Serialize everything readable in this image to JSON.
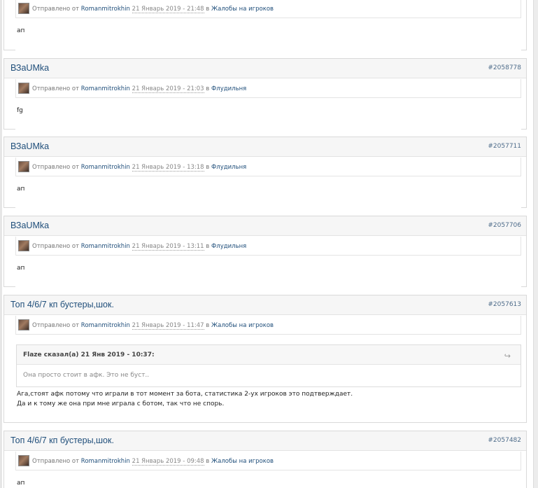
{
  "posts": [
    {
      "title": "",
      "number": "",
      "meta": {
        "prefix": "Отправлено от",
        "author": "Romanmitrokhin",
        "date": "21 Январь 2019 - 21:48",
        "in": "в",
        "forum": "Жалобы на игроков"
      },
      "body": [
        "ап"
      ]
    },
    {
      "title": "ВЗаUMka",
      "number": "#2058778",
      "meta": {
        "prefix": "Отправлено от",
        "author": "Romanmitrokhin",
        "date": "21 Январь 2019 - 21:03",
        "in": "в",
        "forum": "Флудильня"
      },
      "body": [
        "fg"
      ]
    },
    {
      "title": "ВЗаUMka",
      "number": "#2057711",
      "meta": {
        "prefix": "Отправлено от",
        "author": "Romanmitrokhin",
        "date": "21 Январь 2019 - 13:18",
        "in": "в",
        "forum": "Флудильня"
      },
      "body": [
        "ап"
      ]
    },
    {
      "title": "ВЗаUMka",
      "number": "#2057706",
      "meta": {
        "prefix": "Отправлено от",
        "author": "Romanmitrokhin",
        "date": "21 Январь 2019 - 13:11",
        "in": "в",
        "forum": "Флудильня"
      },
      "body": [
        "ап"
      ]
    },
    {
      "title": "Топ 4/6/7 кп бустеры,шок.",
      "number": "#2057613",
      "meta": {
        "prefix": "Отправлено от",
        "author": "Romanmitrokhin",
        "date": "21 Январь 2019 - 11:47",
        "in": "в",
        "forum": "Жалобы на игроков"
      },
      "quote": {
        "cite": "Flaze сказал(а) 21 Янв 2019 - 10:37:",
        "text": "Она просто стоит в афк. Это не буст.."
      },
      "body": [
        "Ага,стоят афк потому что играли в тот момент за бота, статистика 2-ух игроков это подтверждает.",
        "Да и к тому же она при мне играла с ботом, так что не спорь."
      ]
    },
    {
      "title": "Топ 4/6/7 кп бустеры,шок.",
      "number": "#2057482",
      "meta": {
        "prefix": "Отправлено от",
        "author": "Romanmitrokhin",
        "date": "21 Январь 2019 - 09:48",
        "in": "в",
        "forum": "Жалобы на игроков"
      },
      "body": [
        "ап"
      ]
    }
  ]
}
